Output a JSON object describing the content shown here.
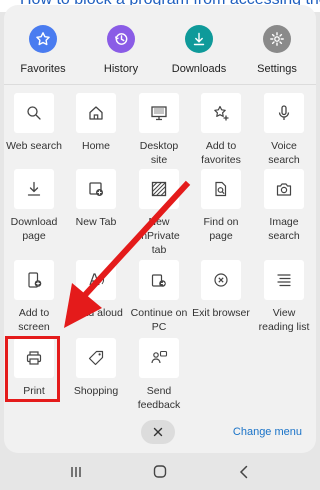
{
  "background": {
    "partial_text": "How to block a program from accessing the"
  },
  "quick_actions": [
    {
      "label": "Favorites",
      "icon": "star-icon",
      "color": "#4a7cf0"
    },
    {
      "label": "History",
      "icon": "history-icon",
      "color": "#8a5ce6"
    },
    {
      "label": "Downloads",
      "icon": "download-icon",
      "color": "#0f9a9a"
    },
    {
      "label": "Settings",
      "icon": "gear-icon",
      "color": "#8a8a8a"
    }
  ],
  "tiles": [
    {
      "label": "Web search",
      "icon": "search-icon"
    },
    {
      "label": "Home",
      "icon": "home-icon"
    },
    {
      "label": "Desktop\nsite",
      "icon": "monitor-icon"
    },
    {
      "label": "Add to\nfavorites",
      "icon": "star-plus-icon"
    },
    {
      "label": "Voice\nsearch",
      "icon": "microphone-icon"
    },
    {
      "label": "Download\npage",
      "icon": "download-page-icon"
    },
    {
      "label": "New Tab",
      "icon": "new-tab-icon"
    },
    {
      "label": "New\nInPrivate\ntab",
      "icon": "inprivate-icon"
    },
    {
      "label": "Find on\npage",
      "icon": "find-on-page-icon"
    },
    {
      "label": "Image\nsearch",
      "icon": "camera-icon"
    },
    {
      "label": "Add to\nscreen",
      "icon": "add-to-screen-icon"
    },
    {
      "label": "Read aloud",
      "icon": "read-aloud-icon"
    },
    {
      "label": "Continue on\nPC",
      "icon": "continue-on-pc-icon"
    },
    {
      "label": "Exit browser",
      "icon": "exit-icon"
    },
    {
      "label": "View\nreading list",
      "icon": "reading-list-icon"
    },
    {
      "label": "Print",
      "icon": "printer-icon"
    },
    {
      "label": "Shopping",
      "icon": "tag-icon"
    },
    {
      "label": "Send\nfeedback",
      "icon": "feedback-icon"
    }
  ],
  "bottom": {
    "change_menu_label": "Change menu"
  },
  "colors": {
    "annotation_red": "#e41b1b",
    "link_blue": "#1a73c8"
  }
}
